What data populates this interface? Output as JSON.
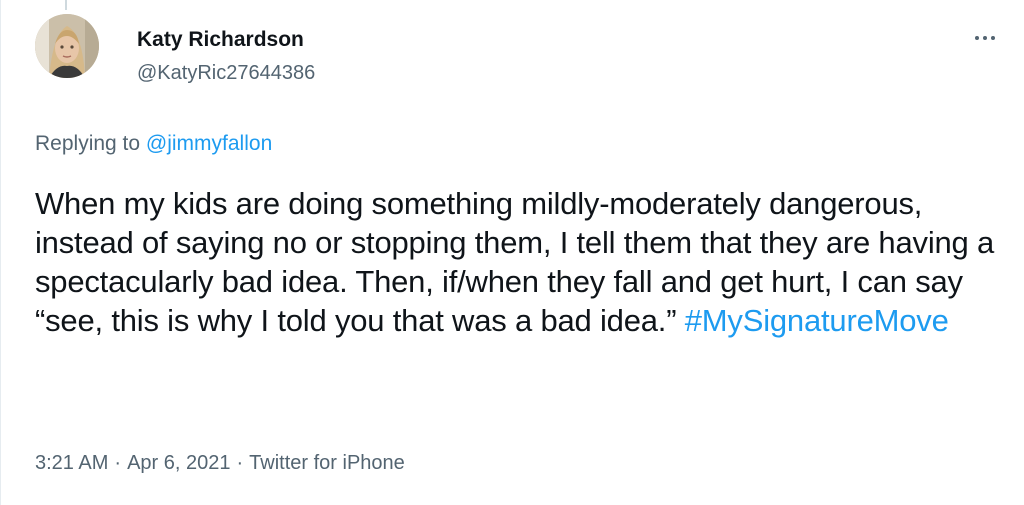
{
  "tweet": {
    "author_name": "Katy Richardson",
    "author_handle": "@KatyRic27644386",
    "replying_prefix": "Replying to",
    "replying_handle": "@jimmyfallon",
    "text": "When my kids are doing something mildly-moderately dangerous, instead of saying no or stopping them, I tell them that they are having a spectacularly bad idea. Then, if/when they fall and get hurt, I can say “see, this is why I told you that was a bad idea.” ",
    "hashtag": "#MySignatureMove",
    "time": "3:21 AM",
    "separator": "·",
    "date": "Apr 6, 2021",
    "source": "Twitter for iPhone"
  },
  "icons": {
    "more": "more-horizontal-icon"
  },
  "colors": {
    "link": "#1d9bf0",
    "text": "#0f1419",
    "secondary": "#536471"
  }
}
